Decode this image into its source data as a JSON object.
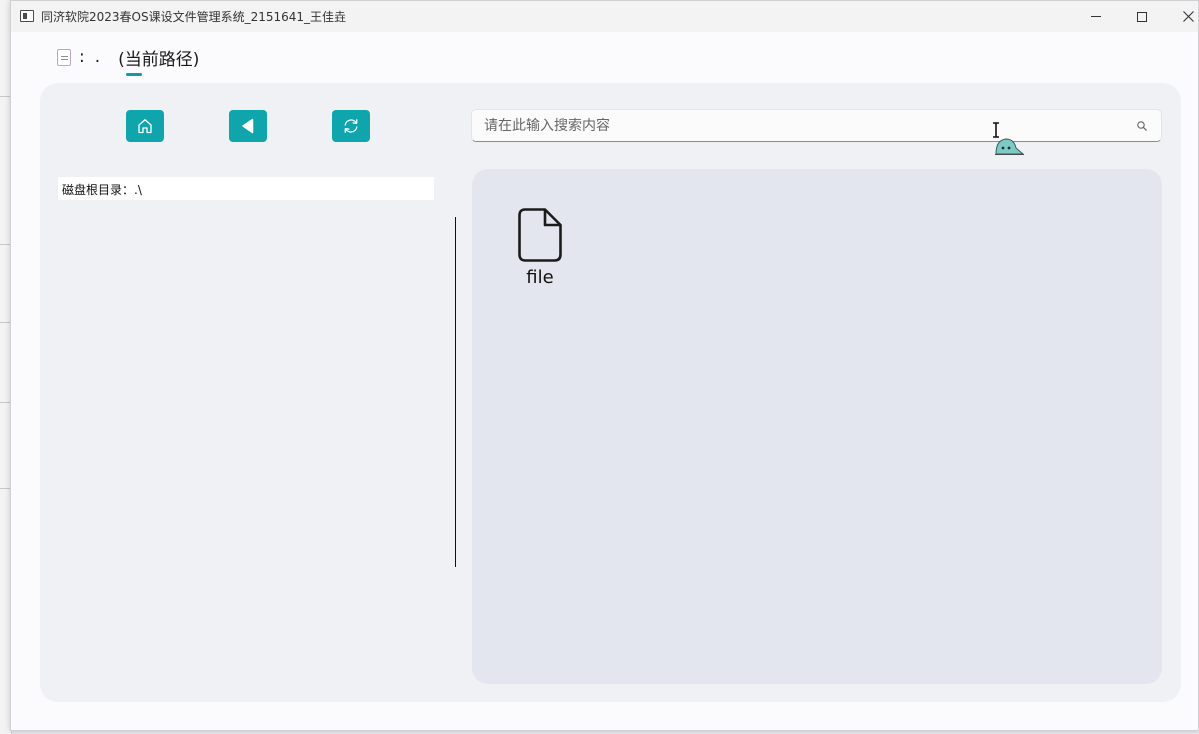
{
  "window": {
    "title": "同济软院2023春OS课设文件管理系统_2151641_王佳垚"
  },
  "path_bar": {
    "colon": ":",
    "value": ".",
    "label": "(当前路径)"
  },
  "toolbar": {
    "home_icon": "home-icon",
    "back_icon": "back-icon",
    "refresh_icon": "refresh-icon",
    "accent_color": "#0ea5ad"
  },
  "search": {
    "placeholder": "请在此输入搜索内容",
    "value": ""
  },
  "tree": {
    "root_label": "磁盘根目录：.\\"
  },
  "files": [
    {
      "name": "file",
      "icon": "file-icon"
    }
  ]
}
